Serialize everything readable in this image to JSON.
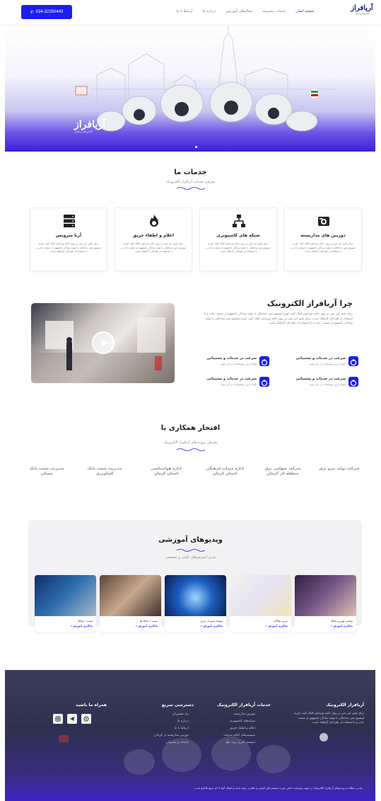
{
  "header": {
    "phone": "034-32250443",
    "nav": [
      "صفحه اصلی",
      "خدمات مجموعه",
      "مقاله‌های آموزشی",
      "درباره ما",
      "ارتباط با ما"
    ],
    "logo_text": "آریافراز",
    "logo_sub": "الکترونیک آریافراز"
  },
  "hero": {
    "logo_text": "آریافراز",
    "logo_sub": "الکترونیک آریافراز"
  },
  "services": {
    "title": "خدمات ما",
    "subtitle": "معرفی خدمات آریافراز الکترونیک",
    "items": [
      {
        "icon": "camera-icon",
        "title": "دوربین های مداربسته",
        "desc": "برای تغییر این متن بر روی دکمه ویرایش کلیک کنید. لورم ایپسوم متن ساختگی با تولید سادگی نامفهوم از صنعت چاپ و با استفاده از طراحان گرافیک است."
      },
      {
        "icon": "network-icon",
        "title": "شبکه های کامپیوتری",
        "desc": "برای تغییر این متن بر روی دکمه ویرایش کلیک کنید. لورم ایپسوم متن ساختگی با تولید سادگی نامفهوم از صنعت چاپ و با استفاده از طراحان گرافیک است."
      },
      {
        "icon": "fire-icon",
        "title": "اعلام و اطفاء حریق",
        "desc": "برای تغییر این متن بر روی دکمه ویرایش کلیک کنید. لورم ایپسوم متن ساختگی با تولید سادگی نامفهوم از صنعت چاپ و با استفاده از طراحان گرافیک است."
      },
      {
        "icon": "server-icon",
        "title": "آریا سرویس",
        "desc": "برای تغییر این متن بر روی دکمه ویرایش کلیک کنید. لورم ایپسوم متن ساختگی با تولید سادگی نامفهوم از صنعت چاپ و با استفاده از طراحان گرافیک است."
      }
    ]
  },
  "why": {
    "title": "چرا آریافراز الکترونیک",
    "text": "برای تغییر این متن بر روی دکمه ویرایش کلیک کنید. لورم ایپسوم متن ساختگی با تولید سادگی نامفهوم از صنعت چاپ و با استفاده از طراحان گرافیک است. برای تغییر این متن بر روی دکمه ویرایش کلیک کنید. لورم ایپسوم متن ساختگی با تولید سادگی نامفهوم از صنعت چاپ و با استفاده از طراحان گرافیک است.",
    "features": [
      {
        "title": "سرعت در خدمات و پشتیبانی",
        "desc": "کوتاه ترین توضیحات در این مورد"
      },
      {
        "title": "سرعت در خدمات و پشتیبانی",
        "desc": "کوتاه ترین توضیحات در این مورد"
      },
      {
        "title": "سرعت در خدمات و پشتیبانی",
        "desc": "کوتاه ترین توضیحات در این مورد"
      },
      {
        "title": "سرعت در خدمات و پشتیبانی",
        "desc": "کوتاه ترین توضیحات در این مورد"
      }
    ]
  },
  "partners": {
    "title": "افتخار همکاری با",
    "subtitle": "معرفی پروژه های آریافراز الکترونیک",
    "items": [
      "شرکت تولید نیرو برق",
      "شرکت سهامی برق منطقه ای کرمان",
      "اداره میراث فرهنگی استان کرمان",
      "اداره هواشناسی استان کرمان",
      "مدیریت شعب بانک کشاورزی",
      "مدیریت شعب بانک مسکن"
    ]
  },
  "videos": {
    "title": "ویدیوهای آموزشی",
    "subtitle": "سری آموزش‌های علمی و تخصصی",
    "items": [
      {
        "title": "نوشتن بهترین مقاله",
        "link": "یادگیری آموزش »"
      },
      {
        "title": "سری مقالات",
        "link": "یادگیری آموزش »"
      },
      {
        "title": "نوشته سوم از سری",
        "link": "یادگیری آموزش »"
      },
      {
        "title": "تست ۲ مقاله ها",
        "link": "یادگیری آموزش »"
      },
      {
        "title": "تست ۱ مقاله",
        "link": "یادگیری آموزش »"
      }
    ]
  },
  "footer": {
    "about_title": "آریافراز الکترونیک",
    "about_text": "برای تغییر این متن بر روی دکمه ویرایش کلیک کنید. لورم ایپسوم متن ساختگی با تولید سادگی نامفهوم از صنعت چاپ و با استفاده از طراحان گرافیک است.",
    "services_title": "خدمات آریافراز الکترونیک",
    "services_links": [
      "دوربین مداربسته",
      "شبکه‌های کامپیوتری",
      "اعلام و اطفاء حریق",
      "سیستم‌های اعلام سرقت",
      "سیستم کنترل تردد تلوا"
    ],
    "quick_title": "دسترسی سریع",
    "quick_links": [
      "پنل مشتریان",
      "درباره ما",
      "ارتباط با ما",
      "دوربین مداربسته در کرمان",
      "خدمات و پشتیبانی"
    ],
    "social_title": "همراه ما باشید",
    "copyright": "تمامی مطالب و ویدیوهای آریافراز الکترونیک در جهت پیشرفت دانش حوزه سیستم های امنیتی و نظارتی تولید شده و انتقال آنها با ذکر منبع بلامانع است."
  },
  "colors": {
    "accent": "#1d1df0",
    "footer": "#2e3050"
  }
}
